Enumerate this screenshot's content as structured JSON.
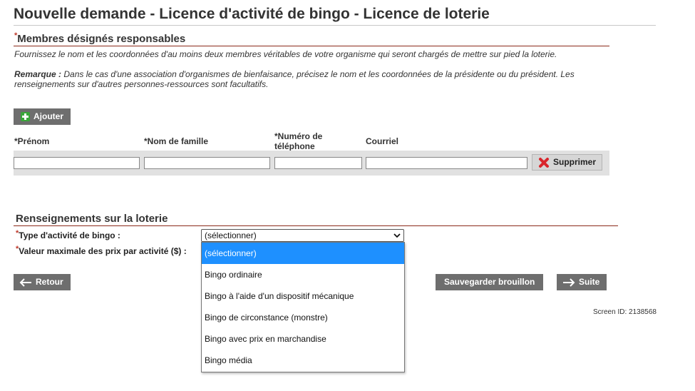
{
  "page": {
    "title": "Nouvelle demande - Licence d'activité de bingo - Licence de loterie",
    "screen_id": "Screen ID: 2138568"
  },
  "members": {
    "required_mark": "*",
    "heading": "Membres désignés responsables",
    "instruction": "Fournissez le nom et les coordonnées d'au moins deux membres véritables de votre organisme qui seront chargés de mettre sur pied la loterie.",
    "remark_label": "Remarque :",
    "remark_text": " Dans le cas d'une association d'organismes de bienfaisance, précisez le nom et les coordonnées de la présidente ou du président. Les renseignements sur d'autres personnes-ressources sont facultatifs.",
    "add_label": "Ajouter",
    "columns": {
      "first_name": "*Prénom",
      "last_name": "*Nom de famille",
      "phone": "*Numéro de téléphone",
      "email": "Courriel"
    },
    "delete_label": "Supprimer",
    "row": {
      "first_name": "",
      "last_name": "",
      "phone": "",
      "email": ""
    }
  },
  "lottery": {
    "heading": "Renseignements sur la loterie",
    "bingo_type_label": "Type d'activité de bingo :",
    "max_prize_label": "Valeur maximale des prix par activité ($) :",
    "bingo_type_value": "(sélectionner)",
    "options": [
      "(sélectionner)",
      "Bingo ordinaire",
      "Bingo à l'aide d'un dispositif mécanique",
      "Bingo de circonstance (monstre)",
      "Bingo avec prix en marchandise",
      "Bingo média"
    ]
  },
  "nav": {
    "back_label": "Retour",
    "save_draft_label": "Sauvegarder brouillon",
    "next_label": "Suite"
  },
  "colors": {
    "accent_rule": "#8b2a1a",
    "button_bg": "#6e6e6e",
    "selected_option": "#1e90ff",
    "required_mark": "#c0392b"
  },
  "icons": [
    "plus-icon",
    "close-icon",
    "arrow-left-icon",
    "arrow-right-icon",
    "chevron-down-icon"
  ]
}
